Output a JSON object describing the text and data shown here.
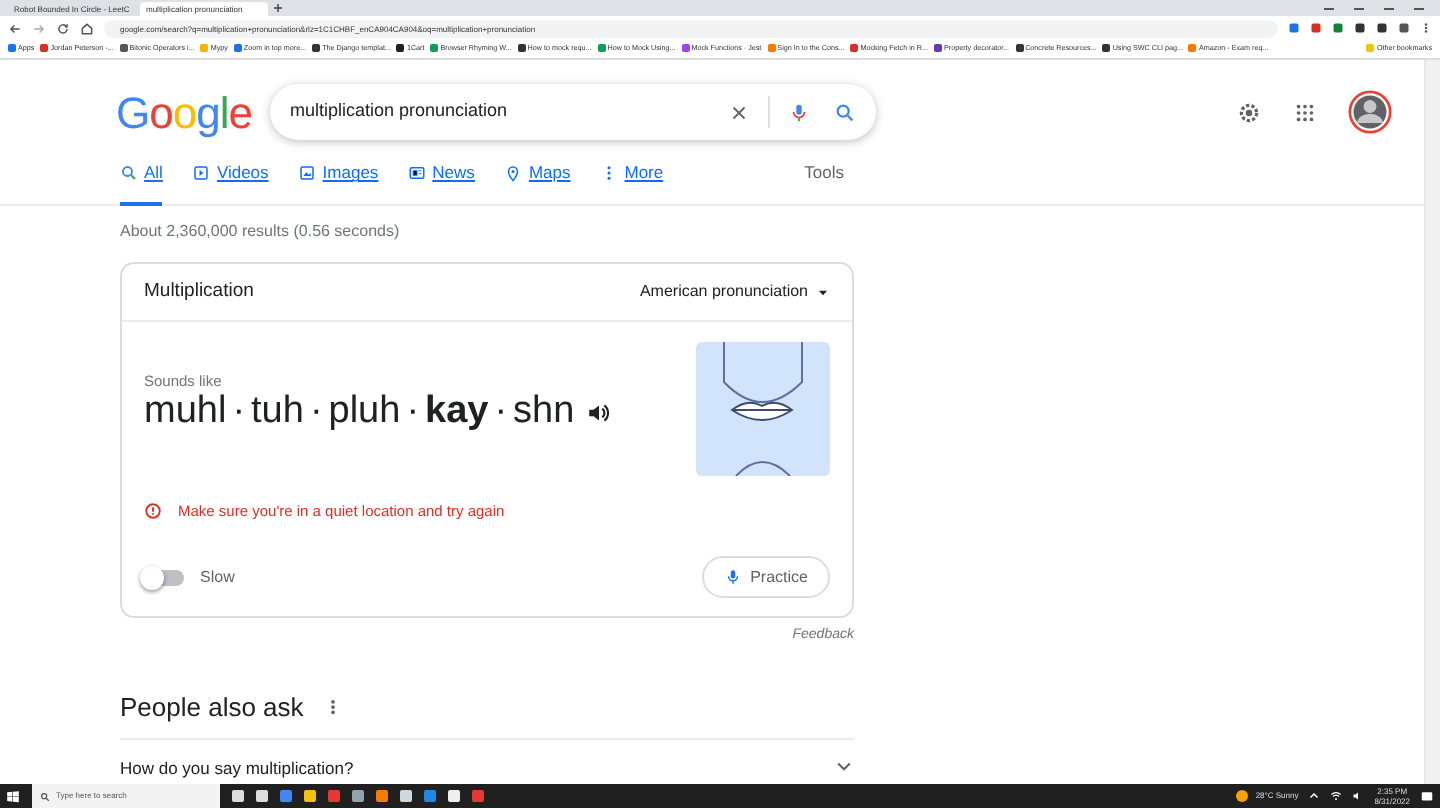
{
  "browser": {
    "tabs": [
      {
        "title": "Robot Bounded In Circle - LeetC",
        "selected": false
      },
      {
        "title": "multiplication pronunciation",
        "selected": true
      }
    ],
    "url": "google.com/search?q=multiplication+pronunciation&rlz=1C1CHBF_enCA904CA904&oq=multiplication+pronunciation",
    "bookmarks": [
      "Apps",
      "Jordan Peterson -...",
      "Bitonic Operators i...",
      "Mypy",
      "Zoom in top more...",
      "The Django templat...",
      "1Cart",
      "Browser Rhyming W...",
      "How to mock requ...",
      "How to Mock Using...",
      "Mock Functions · Jest",
      "Sign In to the Cons...",
      "Mocking Fetch in R...",
      "Property decorator...",
      "Concrete Resources...",
      "Using SWC CLI pag...",
      "Amazon - Exam req..."
    ],
    "other_bookmarks": "Other bookmarks"
  },
  "logo": "Google",
  "search": {
    "value": "multiplication pronunciation"
  },
  "nav_tabs": [
    {
      "label": "All",
      "selected": true
    },
    {
      "label": "Videos",
      "selected": false
    },
    {
      "label": "Images",
      "selected": false
    },
    {
      "label": "News",
      "selected": false
    },
    {
      "label": "Maps",
      "selected": false
    },
    {
      "label": "More",
      "selected": false
    }
  ],
  "tools": "Tools",
  "result_stats": "About 2,360,000 results (0.56 seconds)",
  "pronunciation_card": {
    "word": "Multiplication",
    "accent": "American pronunciation",
    "sounds_like": "Sounds like",
    "phonetic": [
      {
        "kind": "syllable",
        "text": "muhl",
        "stressed": false
      },
      {
        "kind": "dot",
        "text": "·"
      },
      {
        "kind": "syllable",
        "text": "tuh",
        "stressed": false
      },
      {
        "kind": "dot",
        "text": "·"
      },
      {
        "kind": "syllable",
        "text": "pluh",
        "stressed": false
      },
      {
        "kind": "dot",
        "text": "·"
      },
      {
        "kind": "syllable",
        "text": "kay",
        "stressed": true
      },
      {
        "kind": "dot",
        "text": "·"
      },
      {
        "kind": "syllable",
        "text": "shn",
        "stressed": false
      }
    ],
    "error": "Make sure you're in a quiet location and try again",
    "slow": {
      "label": "Slow",
      "on": false
    },
    "practice": "Practice",
    "feedback": "Feedback"
  },
  "people_also_ask": {
    "title": "People also ask",
    "questions": [
      "How do you say multiplication?"
    ]
  },
  "taskbar": {
    "search_placeholder": "Type here to search",
    "weather": "28°C Sunny",
    "time": "2:35 PM",
    "date": "8/31/2022"
  }
}
